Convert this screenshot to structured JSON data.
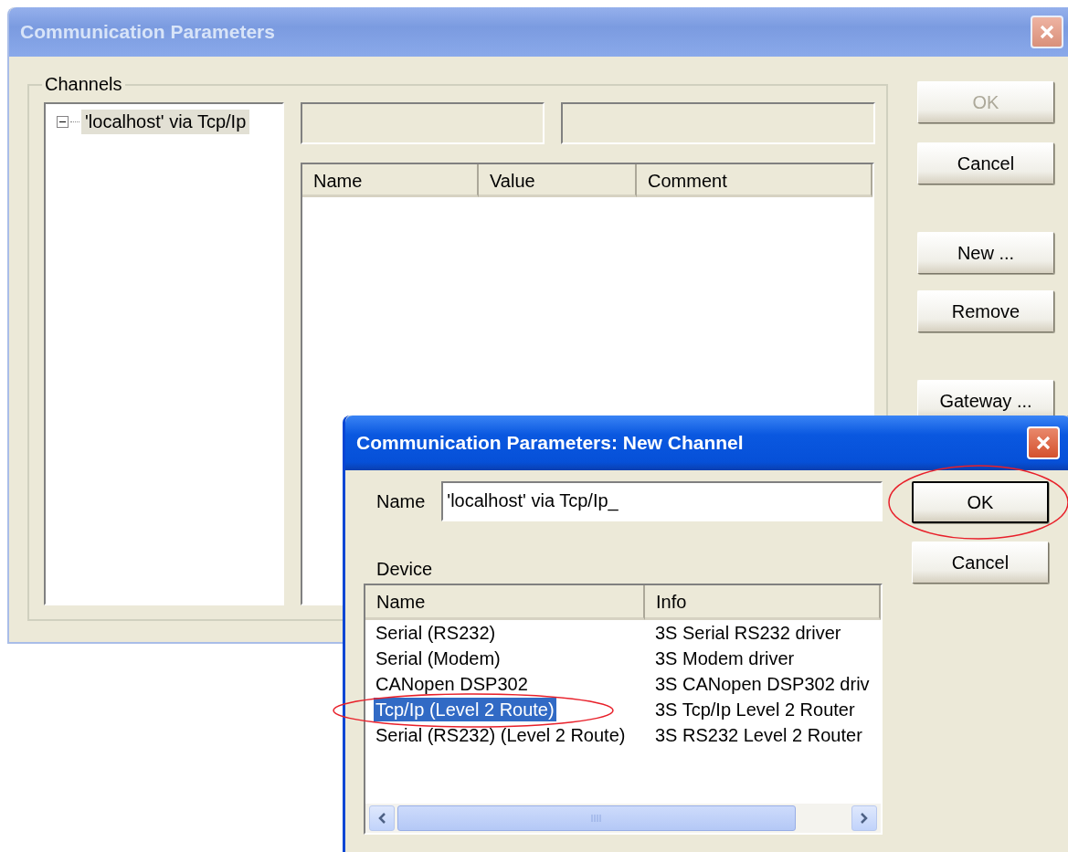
{
  "main_window": {
    "title": "Communication Parameters",
    "channels_group": {
      "label": "Channels",
      "tree": [
        {
          "label": "'localhost' via Tcp/Ip",
          "expanded": true,
          "selected": true
        }
      ],
      "table": {
        "columns": [
          "Name",
          "Value",
          "Comment"
        ]
      }
    },
    "buttons": [
      {
        "label": "OK",
        "disabled": true
      },
      {
        "label": "Cancel",
        "disabled": false
      },
      {
        "label": "New ...",
        "disabled": false
      },
      {
        "label": "Remove",
        "disabled": false
      },
      {
        "label": "Gateway ...",
        "disabled": false
      }
    ]
  },
  "dialog": {
    "title": "Communication Parameters: New Channel",
    "name_label": "Name",
    "name_value": "'localhost' via Tcp/Ip_",
    "device_label": "Device",
    "device_table": {
      "columns": [
        "Name",
        "Info"
      ],
      "rows": [
        {
          "name": "Serial (RS232)",
          "info": "3S Serial RS232 driver",
          "selected": false,
          "circled": false
        },
        {
          "name": "Serial (Modem)",
          "info": "3S Modem driver",
          "selected": false,
          "circled": false
        },
        {
          "name": "CANopen DSP302",
          "info": "3S CANopen DSP302 driv",
          "selected": false,
          "circled": false
        },
        {
          "name": "Tcp/Ip (Level 2 Route)",
          "info": "3S Tcp/Ip Level 2 Router",
          "selected": true,
          "circled": true
        },
        {
          "name": "Serial (RS232) (Level 2 Route)",
          "info": "3S RS232 Level 2 Router",
          "selected": false,
          "circled": false
        }
      ]
    },
    "buttons": [
      {
        "label": "OK",
        "default": true,
        "circled": true
      },
      {
        "label": "Cancel",
        "default": false,
        "circled": false
      }
    ]
  }
}
